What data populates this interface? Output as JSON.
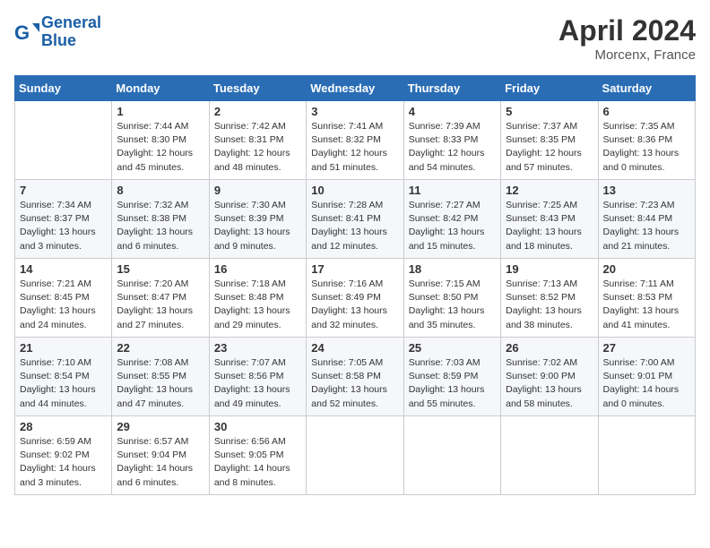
{
  "header": {
    "logo_line1": "General",
    "logo_line2": "Blue",
    "month_title": "April 2024",
    "location": "Morcenx, France"
  },
  "weekdays": [
    "Sunday",
    "Monday",
    "Tuesday",
    "Wednesday",
    "Thursday",
    "Friday",
    "Saturday"
  ],
  "weeks": [
    [
      {
        "day": "",
        "info": ""
      },
      {
        "day": "1",
        "info": "Sunrise: 7:44 AM\nSunset: 8:30 PM\nDaylight: 12 hours\nand 45 minutes."
      },
      {
        "day": "2",
        "info": "Sunrise: 7:42 AM\nSunset: 8:31 PM\nDaylight: 12 hours\nand 48 minutes."
      },
      {
        "day": "3",
        "info": "Sunrise: 7:41 AM\nSunset: 8:32 PM\nDaylight: 12 hours\nand 51 minutes."
      },
      {
        "day": "4",
        "info": "Sunrise: 7:39 AM\nSunset: 8:33 PM\nDaylight: 12 hours\nand 54 minutes."
      },
      {
        "day": "5",
        "info": "Sunrise: 7:37 AM\nSunset: 8:35 PM\nDaylight: 12 hours\nand 57 minutes."
      },
      {
        "day": "6",
        "info": "Sunrise: 7:35 AM\nSunset: 8:36 PM\nDaylight: 13 hours\nand 0 minutes."
      }
    ],
    [
      {
        "day": "7",
        "info": "Sunrise: 7:34 AM\nSunset: 8:37 PM\nDaylight: 13 hours\nand 3 minutes."
      },
      {
        "day": "8",
        "info": "Sunrise: 7:32 AM\nSunset: 8:38 PM\nDaylight: 13 hours\nand 6 minutes."
      },
      {
        "day": "9",
        "info": "Sunrise: 7:30 AM\nSunset: 8:39 PM\nDaylight: 13 hours\nand 9 minutes."
      },
      {
        "day": "10",
        "info": "Sunrise: 7:28 AM\nSunset: 8:41 PM\nDaylight: 13 hours\nand 12 minutes."
      },
      {
        "day": "11",
        "info": "Sunrise: 7:27 AM\nSunset: 8:42 PM\nDaylight: 13 hours\nand 15 minutes."
      },
      {
        "day": "12",
        "info": "Sunrise: 7:25 AM\nSunset: 8:43 PM\nDaylight: 13 hours\nand 18 minutes."
      },
      {
        "day": "13",
        "info": "Sunrise: 7:23 AM\nSunset: 8:44 PM\nDaylight: 13 hours\nand 21 minutes."
      }
    ],
    [
      {
        "day": "14",
        "info": "Sunrise: 7:21 AM\nSunset: 8:45 PM\nDaylight: 13 hours\nand 24 minutes."
      },
      {
        "day": "15",
        "info": "Sunrise: 7:20 AM\nSunset: 8:47 PM\nDaylight: 13 hours\nand 27 minutes."
      },
      {
        "day": "16",
        "info": "Sunrise: 7:18 AM\nSunset: 8:48 PM\nDaylight: 13 hours\nand 29 minutes."
      },
      {
        "day": "17",
        "info": "Sunrise: 7:16 AM\nSunset: 8:49 PM\nDaylight: 13 hours\nand 32 minutes."
      },
      {
        "day": "18",
        "info": "Sunrise: 7:15 AM\nSunset: 8:50 PM\nDaylight: 13 hours\nand 35 minutes."
      },
      {
        "day": "19",
        "info": "Sunrise: 7:13 AM\nSunset: 8:52 PM\nDaylight: 13 hours\nand 38 minutes."
      },
      {
        "day": "20",
        "info": "Sunrise: 7:11 AM\nSunset: 8:53 PM\nDaylight: 13 hours\nand 41 minutes."
      }
    ],
    [
      {
        "day": "21",
        "info": "Sunrise: 7:10 AM\nSunset: 8:54 PM\nDaylight: 13 hours\nand 44 minutes."
      },
      {
        "day": "22",
        "info": "Sunrise: 7:08 AM\nSunset: 8:55 PM\nDaylight: 13 hours\nand 47 minutes."
      },
      {
        "day": "23",
        "info": "Sunrise: 7:07 AM\nSunset: 8:56 PM\nDaylight: 13 hours\nand 49 minutes."
      },
      {
        "day": "24",
        "info": "Sunrise: 7:05 AM\nSunset: 8:58 PM\nDaylight: 13 hours\nand 52 minutes."
      },
      {
        "day": "25",
        "info": "Sunrise: 7:03 AM\nSunset: 8:59 PM\nDaylight: 13 hours\nand 55 minutes."
      },
      {
        "day": "26",
        "info": "Sunrise: 7:02 AM\nSunset: 9:00 PM\nDaylight: 13 hours\nand 58 minutes."
      },
      {
        "day": "27",
        "info": "Sunrise: 7:00 AM\nSunset: 9:01 PM\nDaylight: 14 hours\nand 0 minutes."
      }
    ],
    [
      {
        "day": "28",
        "info": "Sunrise: 6:59 AM\nSunset: 9:02 PM\nDaylight: 14 hours\nand 3 minutes."
      },
      {
        "day": "29",
        "info": "Sunrise: 6:57 AM\nSunset: 9:04 PM\nDaylight: 14 hours\nand 6 minutes."
      },
      {
        "day": "30",
        "info": "Sunrise: 6:56 AM\nSunset: 9:05 PM\nDaylight: 14 hours\nand 8 minutes."
      },
      {
        "day": "",
        "info": ""
      },
      {
        "day": "",
        "info": ""
      },
      {
        "day": "",
        "info": ""
      },
      {
        "day": "",
        "info": ""
      }
    ]
  ]
}
